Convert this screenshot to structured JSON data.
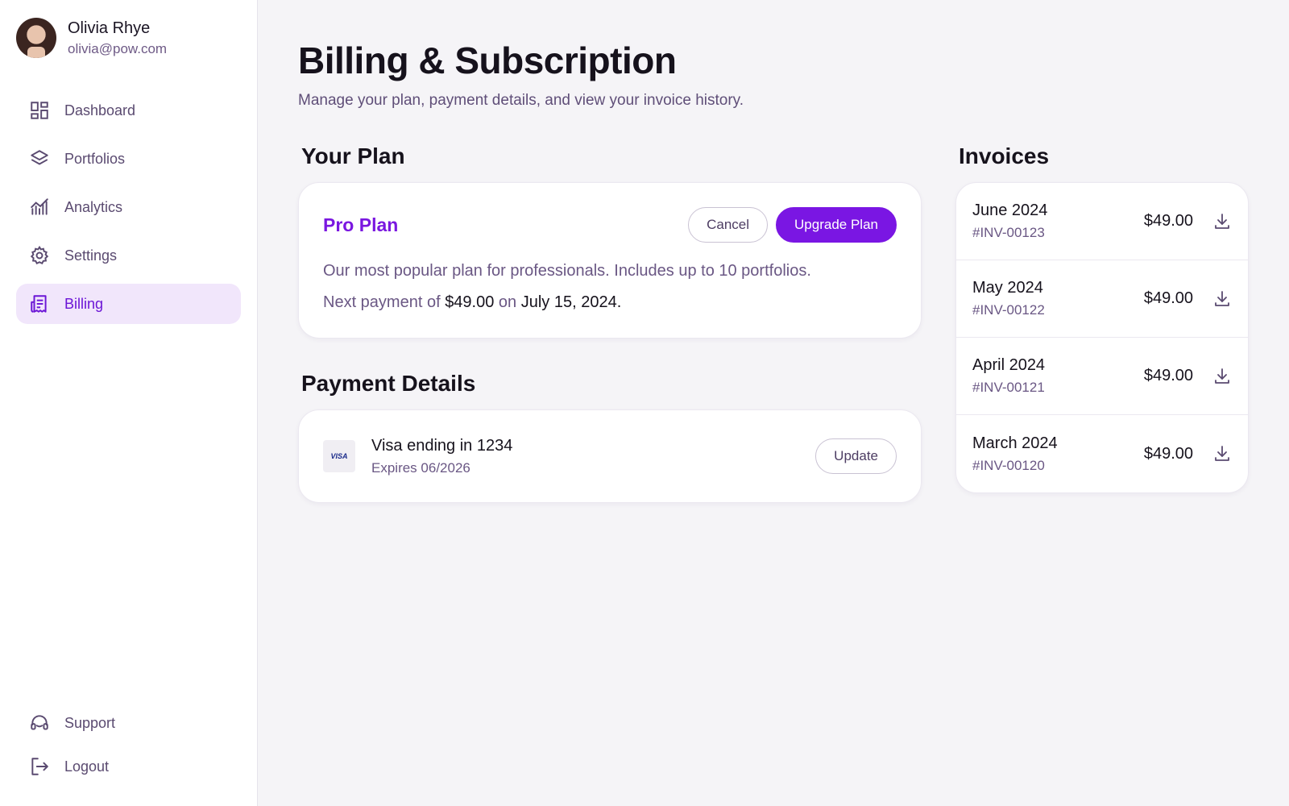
{
  "user": {
    "name": "Olivia Rhye",
    "email": "olivia@pow.com"
  },
  "sidebar": {
    "items": [
      {
        "label": "Dashboard",
        "icon": "dashboard-icon"
      },
      {
        "label": "Portfolios",
        "icon": "layers-icon"
      },
      {
        "label": "Analytics",
        "icon": "analytics-icon"
      },
      {
        "label": "Settings",
        "icon": "gear-icon"
      },
      {
        "label": "Billing",
        "icon": "receipt-icon",
        "active": true
      }
    ],
    "bottom": [
      {
        "label": "Support",
        "icon": "headset-icon"
      },
      {
        "label": "Logout",
        "icon": "logout-icon"
      }
    ]
  },
  "page": {
    "title": "Billing & Subscription",
    "subtitle": "Manage your plan, payment details, and view your invoice history."
  },
  "plan": {
    "section_title": "Your Plan",
    "name": "Pro Plan",
    "cancel_label": "Cancel",
    "upgrade_label": "Upgrade Plan",
    "description": "Our most popular plan for professionals. Includes up to 10 portfolios.",
    "next_prefix": "Next payment of",
    "next_amount": "$49.00",
    "next_on": "on",
    "next_date": "July 15, 2024",
    "next_suffix": "."
  },
  "payment": {
    "section_title": "Payment Details",
    "card_brand": "VISA",
    "card_label": "Visa ending in 1234",
    "expires": "Expires 06/2026",
    "update_label": "Update"
  },
  "invoices": {
    "section_title": "Invoices",
    "items": [
      {
        "month": "June 2024",
        "id": "#INV-00123",
        "amount": "$49.00"
      },
      {
        "month": "May 2024",
        "id": "#INV-00122",
        "amount": "$49.00"
      },
      {
        "month": "April 2024",
        "id": "#INV-00121",
        "amount": "$49.00"
      },
      {
        "month": "March 2024",
        "id": "#INV-00120",
        "amount": "$49.00"
      }
    ]
  },
  "colors": {
    "accent": "#7a16e3",
    "active_nav_bg": "#f1e6fb",
    "muted_text": "#6a5784"
  }
}
